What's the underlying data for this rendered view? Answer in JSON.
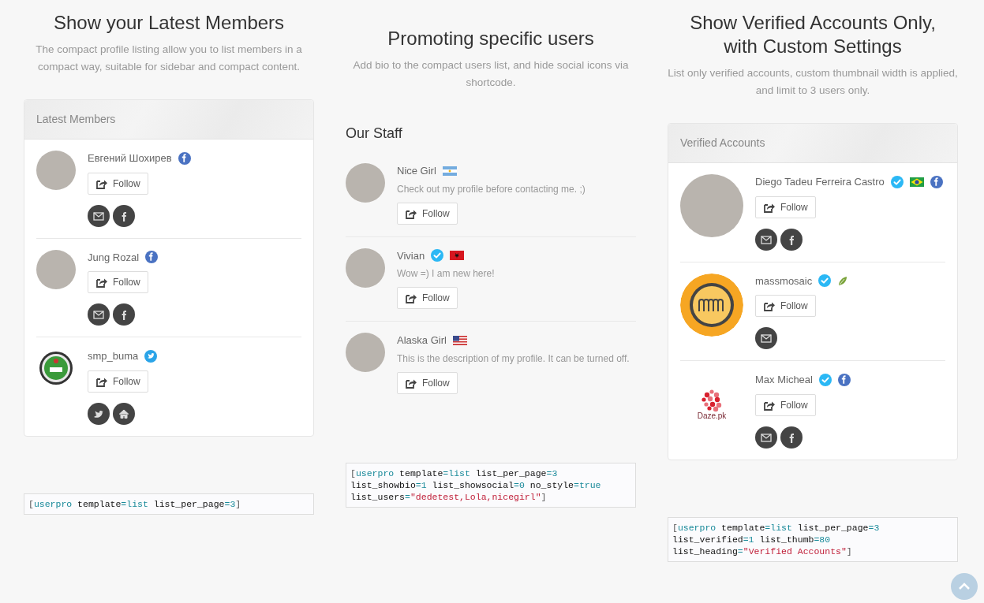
{
  "columns": [
    {
      "heading": "Show your Latest Members",
      "description": "The compact profile listing allow you to list members in a compact way, suitable for sidebar and compact content.",
      "card_heading": "Latest Members",
      "members": [
        {
          "name": "Евгений Шохирев",
          "verified": false,
          "badges": [
            {
              "kind": "facebook"
            }
          ],
          "avatar": {
            "kind": "photo"
          },
          "follow": "Follow",
          "social": [
            {
              "kind": "email"
            },
            {
              "kind": "facebook"
            }
          ]
        },
        {
          "name": "Jung Rozal",
          "verified": false,
          "badges": [
            {
              "kind": "facebook"
            }
          ],
          "avatar": {
            "kind": "photo"
          },
          "follow": "Follow",
          "social": [
            {
              "kind": "email"
            },
            {
              "kind": "facebook"
            }
          ]
        },
        {
          "name": "smp_buma",
          "verified": false,
          "badges": [
            {
              "kind": "twitter"
            }
          ],
          "avatar": {
            "kind": "emblem"
          },
          "follow": "Follow",
          "social": [
            {
              "kind": "twitter"
            },
            {
              "kind": "home"
            }
          ]
        }
      ],
      "code": [
        [
          {
            "kind": "punct",
            "text": "["
          },
          {
            "kind": "keyword",
            "text": "userpro"
          },
          {
            "kind": "plain",
            "text": " template"
          },
          {
            "kind": "keyword",
            "text": "=list"
          },
          {
            "kind": "plain",
            "text": " list_per_page"
          },
          {
            "kind": "keyword",
            "text": "=3"
          },
          {
            "kind": "punct",
            "text": "]"
          }
        ]
      ]
    },
    {
      "heading": "Promoting specific users",
      "description": "Add bio to the compact users list, and hide social icons via shortcode.",
      "list_title": "Our Staff",
      "members": [
        {
          "name": "Nice Girl",
          "verified": false,
          "badges": [
            {
              "kind": "flag-argentina"
            }
          ],
          "avatar": {
            "kind": "photo"
          },
          "bio": "Check out my profile before contacting me. ;)",
          "follow": "Follow"
        },
        {
          "name": "Vivian",
          "verified": true,
          "badges": [
            {
              "kind": "flag-albania"
            }
          ],
          "avatar": {
            "kind": "photo"
          },
          "bio": "Wow =) I am new here!",
          "follow": "Follow"
        },
        {
          "name": "Alaska Girl",
          "verified": false,
          "badges": [
            {
              "kind": "flag-usa"
            }
          ],
          "avatar": {
            "kind": "photo"
          },
          "bio": "This is the description of my profile. It can be turned off.",
          "follow": "Follow"
        }
      ],
      "code": [
        [
          {
            "kind": "punct",
            "text": "["
          },
          {
            "kind": "keyword",
            "text": "userpro"
          },
          {
            "kind": "plain",
            "text": " template"
          },
          {
            "kind": "keyword",
            "text": "=list"
          },
          {
            "kind": "plain",
            "text": " list_per_page"
          },
          {
            "kind": "keyword",
            "text": "=3"
          }
        ],
        [
          {
            "kind": "plain",
            "text": "list_showbio"
          },
          {
            "kind": "keyword",
            "text": "=1"
          },
          {
            "kind": "plain",
            "text": " list_showsocial"
          },
          {
            "kind": "keyword",
            "text": "=0"
          },
          {
            "kind": "plain",
            "text": " no_style"
          },
          {
            "kind": "keyword",
            "text": "=true"
          }
        ],
        [
          {
            "kind": "plain",
            "text": "list_users"
          },
          {
            "kind": "keyword",
            "text": "="
          },
          {
            "kind": "string",
            "text": "\"dedetest,Lola,nicegirl\""
          },
          {
            "kind": "punct",
            "text": "]"
          }
        ]
      ]
    },
    {
      "heading": "Show Verified Accounts Only, with Custom Settings",
      "description": "List only verified accounts, custom thumbnail width is applied, and limit to 3 users only.",
      "card_heading": "Verified Accounts",
      "large_thumbs": true,
      "members": [
        {
          "name": "Diego Tadeu Ferreira Castro",
          "verified": true,
          "badges": [
            {
              "kind": "flag-brazil"
            },
            {
              "kind": "facebook"
            }
          ],
          "avatar": {
            "kind": "photo"
          },
          "follow": "Follow",
          "social": [
            {
              "kind": "email"
            },
            {
              "kind": "facebook"
            }
          ]
        },
        {
          "name": "massmosaic",
          "verified": true,
          "badges": [
            {
              "kind": "leaf"
            }
          ],
          "avatar": {
            "kind": "mosaic-logo"
          },
          "follow": "Follow",
          "social": [
            {
              "kind": "email"
            }
          ]
        },
        {
          "name": "Max Micheal",
          "verified": true,
          "badges": [
            {
              "kind": "facebook"
            }
          ],
          "avatar": {
            "kind": "dots-logo",
            "text": "Daze.pk"
          },
          "follow": "Follow",
          "social": [
            {
              "kind": "email"
            },
            {
              "kind": "facebook"
            }
          ]
        }
      ],
      "code": [
        [
          {
            "kind": "punct",
            "text": "["
          },
          {
            "kind": "keyword",
            "text": "userpro"
          },
          {
            "kind": "plain",
            "text": " template"
          },
          {
            "kind": "keyword",
            "text": "=list"
          },
          {
            "kind": "plain",
            "text": " list_per_page"
          },
          {
            "kind": "keyword",
            "text": "=3"
          }
        ],
        [
          {
            "kind": "plain",
            "text": "list_verified"
          },
          {
            "kind": "keyword",
            "text": "=1"
          },
          {
            "kind": "plain",
            "text": " list_thumb"
          },
          {
            "kind": "keyword",
            "text": "=80"
          }
        ],
        [
          {
            "kind": "plain",
            "text": "list_heading"
          },
          {
            "kind": "keyword",
            "text": "="
          },
          {
            "kind": "string",
            "text": "\"Verified Accounts\""
          },
          {
            "kind": "punct",
            "text": "]"
          }
        ]
      ]
    }
  ]
}
